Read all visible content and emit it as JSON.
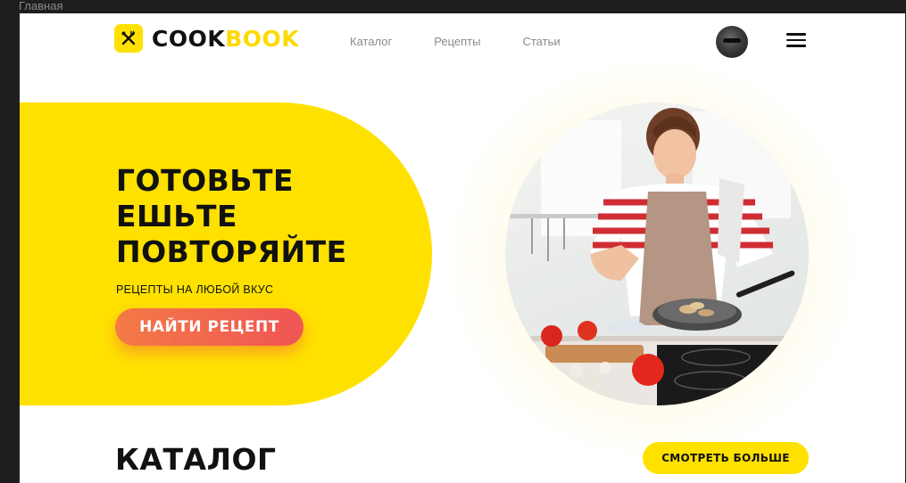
{
  "frame_label": "Главная",
  "brand": {
    "part1": "COOK",
    "part2": "BOOK",
    "icon": "fork-knife-icon"
  },
  "nav": {
    "items": [
      {
        "label": "Каталог"
      },
      {
        "label": "Рецепты"
      },
      {
        "label": "Статьи"
      }
    ]
  },
  "header": {
    "avatar": "user-avatar",
    "menu_icon": "hamburger-menu-icon"
  },
  "hero": {
    "title_lines": [
      "ГОТОВЬТЕ",
      "ЕШЬТЕ",
      "ПОВТОРЯЙТЕ"
    ],
    "subtitle": "РЕЦЕПТЫ НА ЛЮБОЙ ВКУС",
    "cta_label": "НАЙТИ РЕЦЕПТ",
    "photo": "woman-cooking-in-kitchen"
  },
  "catalog": {
    "title": "КАТАЛОГ",
    "more_label": "СМОТРЕТЬ БОЛЬШЕ"
  },
  "colors": {
    "accent_yellow": "#FFE100",
    "cta_gradient_start": "#F47A45",
    "cta_gradient_end": "#EF5555",
    "text_dark": "#111111",
    "nav_gray": "#8B8B8B"
  }
}
